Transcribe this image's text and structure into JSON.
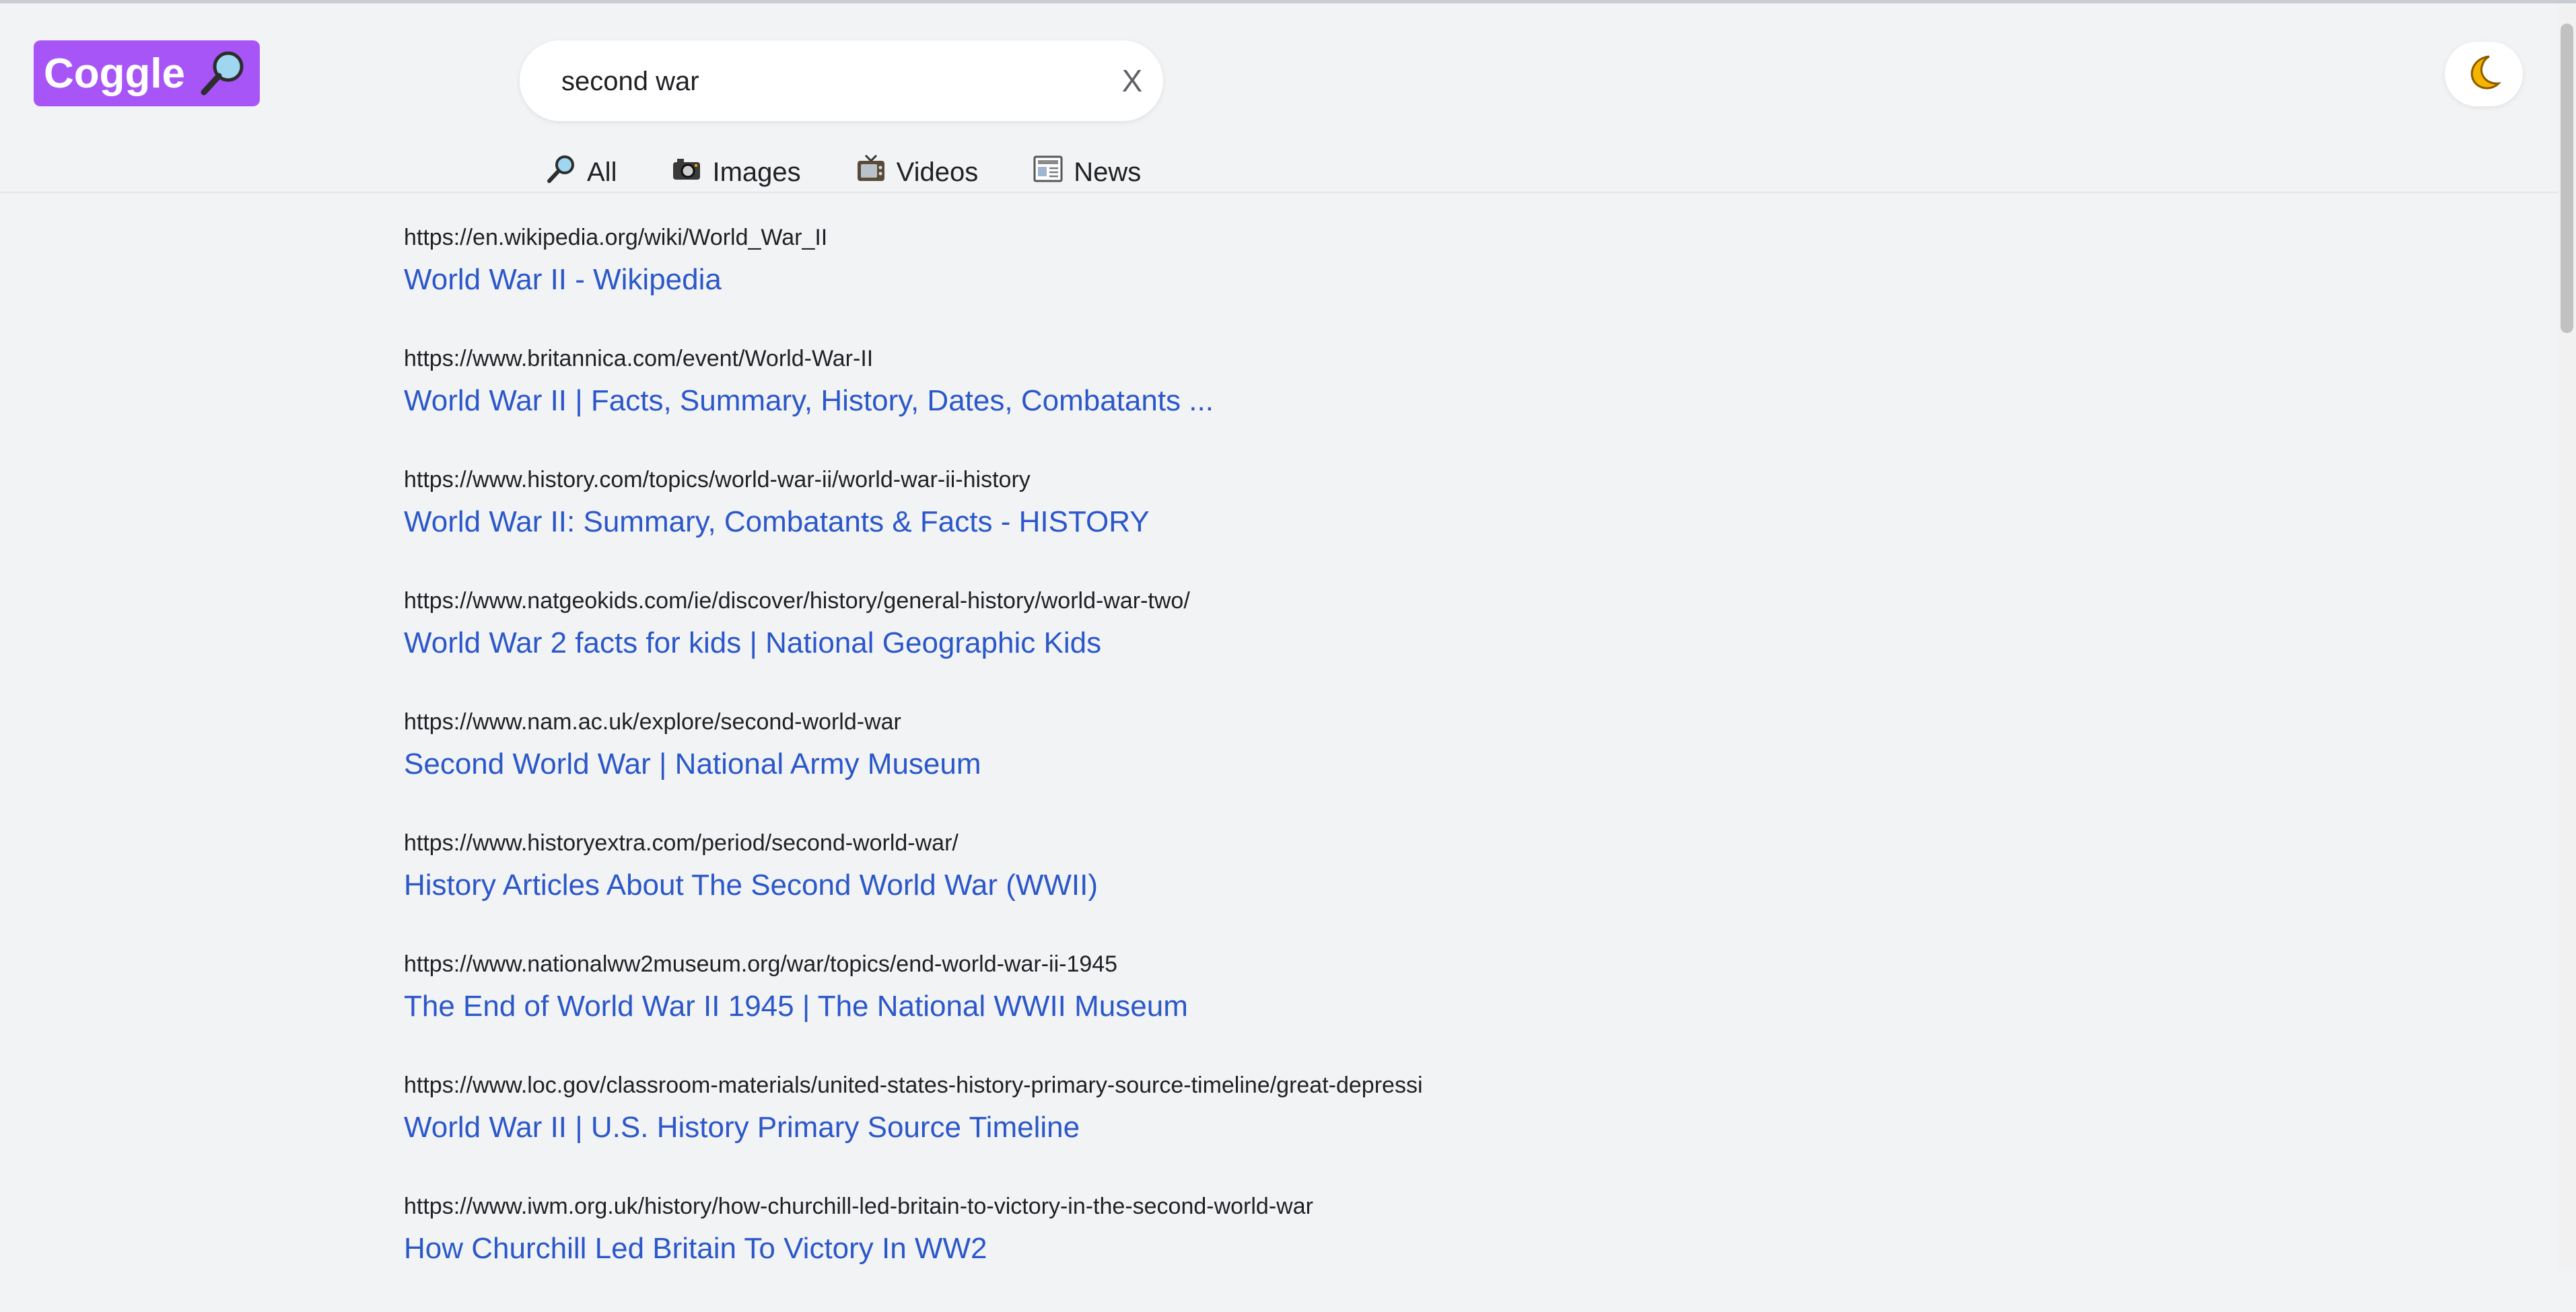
{
  "header": {
    "logo_text": "Coggle",
    "logo_icon": "magnifier-icon",
    "brand_color": "#a855f7",
    "search": {
      "value": "second war",
      "clear_label": "X"
    },
    "theme_toggle_icon": "moon-icon"
  },
  "tabs": [
    {
      "label": "All",
      "icon": "magnifier-icon"
    },
    {
      "label": "Images",
      "icon": "camera-icon"
    },
    {
      "label": "Videos",
      "icon": "tv-icon"
    },
    {
      "label": "News",
      "icon": "newspaper-icon"
    }
  ],
  "results": [
    {
      "url": "https://en.wikipedia.org/wiki/World_War_II",
      "title": "World War II - Wikipedia"
    },
    {
      "url": "https://www.britannica.com/event/World-War-II",
      "title": "World War II | Facts, Summary, History, Dates, Combatants ..."
    },
    {
      "url": "https://www.history.com/topics/world-war-ii/world-war-ii-history",
      "title": "World War II: Summary, Combatants & Facts - HISTORY"
    },
    {
      "url": "https://www.natgeokids.com/ie/discover/history/general-history/world-war-two/",
      "title": "World War 2 facts for kids | National Geographic Kids"
    },
    {
      "url": "https://www.nam.ac.uk/explore/second-world-war",
      "title": "Second World War | National Army Museum"
    },
    {
      "url": "https://www.historyextra.com/period/second-world-war/",
      "title": "History Articles About The Second World War (WWII)"
    },
    {
      "url": "https://www.nationalww2museum.org/war/topics/end-world-war-ii-1945",
      "title": "The End of World War II 1945 | The National WWII Museum"
    },
    {
      "url": "https://www.loc.gov/classroom-materials/united-states-history-primary-source-timeline/great-depressi",
      "title": "World War II | U.S. History Primary Source Timeline"
    },
    {
      "url": "https://www.iwm.org.uk/history/how-churchill-led-britain-to-victory-in-the-second-world-war",
      "title": "How Churchill Led Britain To Victory In WW2"
    }
  ],
  "colors": {
    "link": "#2b57c9",
    "background": "#f1f3f5"
  }
}
